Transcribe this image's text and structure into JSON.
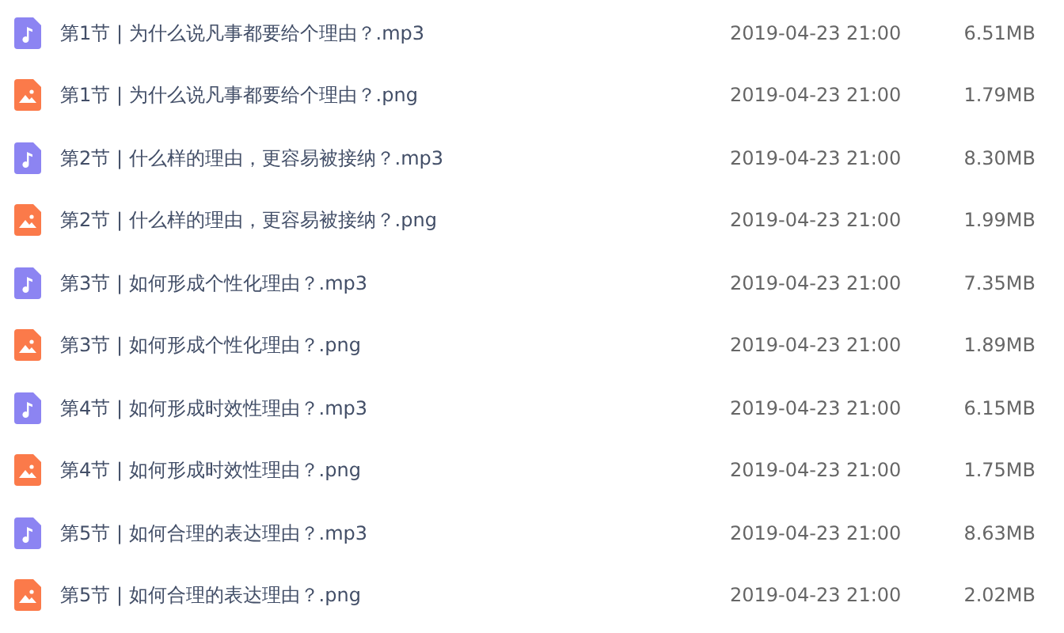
{
  "files": [
    {
      "kind": "audio",
      "name": "第1节 | 为什么说凡事都要给个理由？.mp3",
      "date": "2019-04-23 21:00",
      "size": "6.51MB"
    },
    {
      "kind": "image",
      "name": "第1节 | 为什么说凡事都要给个理由？.png",
      "date": "2019-04-23 21:00",
      "size": "1.79MB"
    },
    {
      "kind": "audio",
      "name": "第2节 | 什么样的理由，更容易被接纳？.mp3",
      "date": "2019-04-23 21:00",
      "size": "8.30MB"
    },
    {
      "kind": "image",
      "name": "第2节 | 什么样的理由，更容易被接纳？.png",
      "date": "2019-04-23 21:00",
      "size": "1.99MB"
    },
    {
      "kind": "audio",
      "name": "第3节 | 如何形成个性化理由？.mp3",
      "date": "2019-04-23 21:00",
      "size": "7.35MB"
    },
    {
      "kind": "image",
      "name": "第3节 | 如何形成个性化理由？.png",
      "date": "2019-04-23 21:00",
      "size": "1.89MB"
    },
    {
      "kind": "audio",
      "name": "第4节 | 如何形成时效性理由？.mp3",
      "date": "2019-04-23 21:00",
      "size": "6.15MB"
    },
    {
      "kind": "image",
      "name": "第4节 | 如何形成时效性理由？.png",
      "date": "2019-04-23 21:00",
      "size": "1.75MB"
    },
    {
      "kind": "audio",
      "name": "第5节 | 如何合理的表达理由？.mp3",
      "date": "2019-04-23 21:00",
      "size": "8.63MB"
    },
    {
      "kind": "image",
      "name": "第5节 | 如何合理的表达理由？.png",
      "date": "2019-04-23 21:00",
      "size": "2.02MB"
    }
  ]
}
